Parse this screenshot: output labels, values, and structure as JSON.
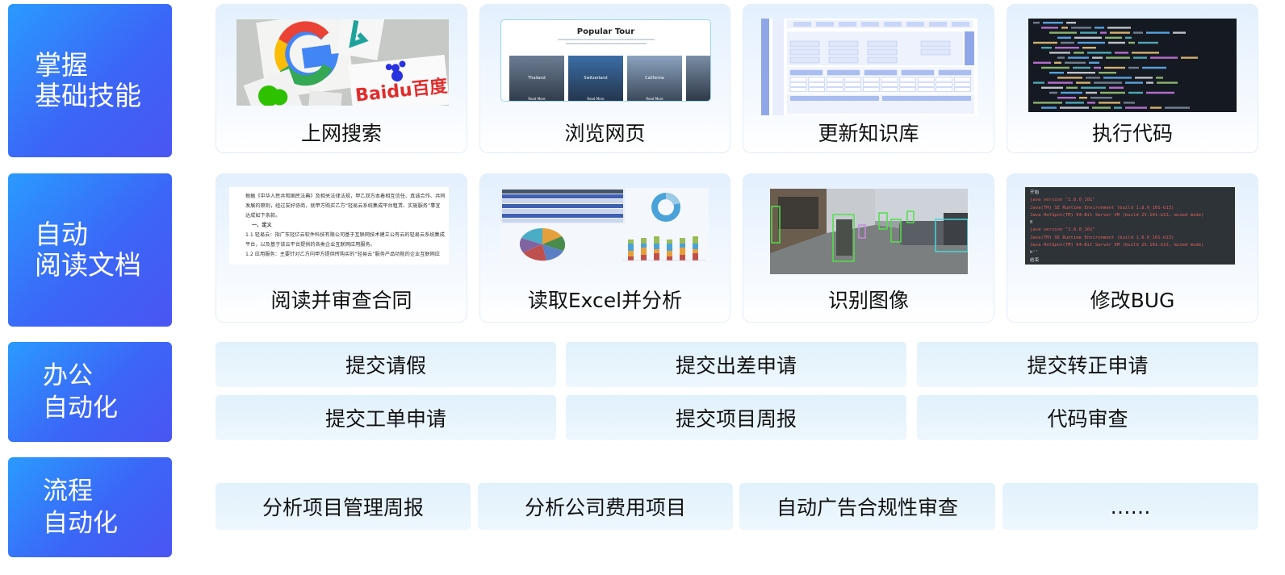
{
  "categories": [
    {
      "line1": "掌握",
      "line2": "基础技能"
    },
    {
      "line1": "自动",
      "line2": "阅读文档"
    },
    {
      "line1": "办公",
      "line2": "自动化"
    },
    {
      "line1": "流程",
      "line2": "自动化"
    }
  ],
  "row1": [
    {
      "label": "上网搜索",
      "thumb_text": "Baidu百度"
    },
    {
      "label": "浏览网页",
      "thumb_title": "Popular Tour",
      "thumb_cards": [
        "Thailand",
        "Switzerland",
        "California"
      ],
      "thumb_button": "Read More"
    },
    {
      "label": "更新知识库"
    },
    {
      "label": "执行代码"
    }
  ],
  "row2": [
    {
      "label": "阅读并审查合同",
      "doc_lines": [
        "根据《中华人民共和国民法典》及相关法律法规，甲乙双方本着相互信任、真诚合作、共同",
        "发展的原则，经过友好协商，就甲方购买乙方“轻易云系统集成平台租赁、实施服务”事宜",
        "达成如下条款。",
        "一、定义",
        "1.1 轻易云：指广东轻亿云软件科技有限公司基于互联网技术建立公有云的轻易云系统集成",
        "平台，以及基于该云平台提供的各类企业互联网应用服务。",
        "1.2 应用服务：主要针对乙方向甲方提供所购买的“轻易云”服务产品功能的企业互联网应"
      ]
    },
    {
      "label": "读取Excel并分析"
    },
    {
      "label": "识别图像"
    },
    {
      "label": "修改BUG",
      "code_lines": [
        {
          "text": "开始",
          "color": "#d8dde3"
        },
        {
          "text": "java version \"1.8.0_101\"",
          "color": "#e0605a"
        },
        {
          "text": "Java(TM) SE Runtime Environment (build 1.8.0_101-b13)",
          "color": "#e0605a"
        },
        {
          "text": "Java HotSpot(TM) 64-Bit Server VM (build 25.101-b13, mixed mode)",
          "color": "#e0605a"
        },
        {
          "text": "0",
          "color": "#d8dde3"
        },
        {
          "text": "java version \"1.8.0_101\"",
          "color": "#e0605a"
        },
        {
          "text": "Java(TM) SE Runtime Environment (build 1.8.0_101-b13)",
          "color": "#e0605a"
        },
        {
          "text": "Java HotSpot(TM) 64-Bit Server VM (build 25.101-b13, mixed mode)",
          "color": "#e0605a"
        },
        {
          "text": "b''",
          "color": "#d8dde3"
        },
        {
          "text": "结束",
          "color": "#d8dde3"
        }
      ]
    }
  ],
  "office": [
    "提交请假",
    "提交出差申请",
    "提交转正申请",
    "提交工单申请",
    "提交项目周报",
    "代码审查"
  ],
  "process": [
    "分析项目管理周报",
    "分析公司费用项目",
    "自动广告合规性审查",
    "……"
  ]
}
